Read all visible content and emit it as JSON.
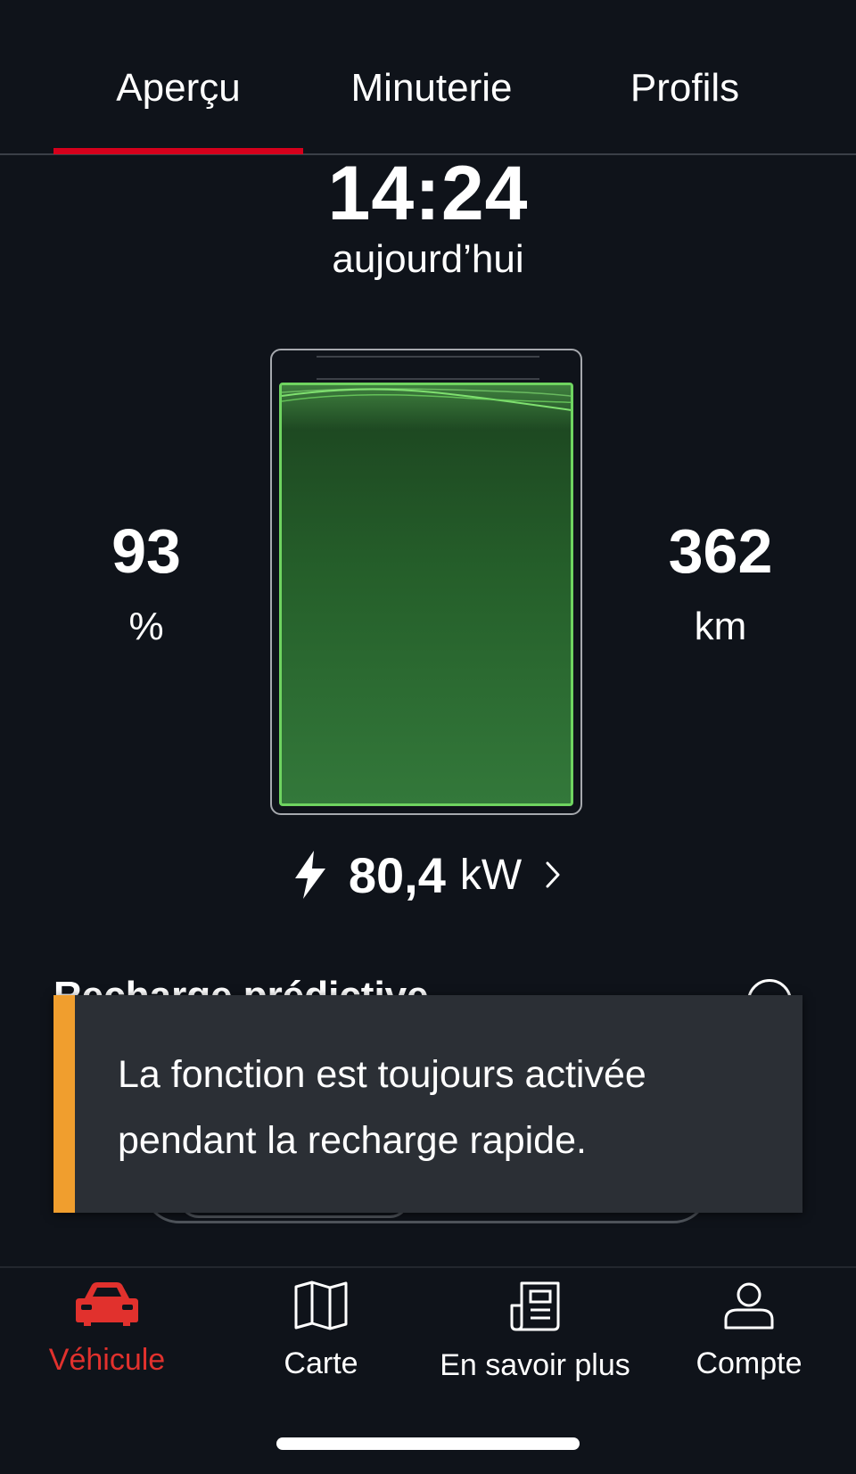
{
  "tabs": {
    "overview": "Aperçu",
    "timer": "Minuterie",
    "profiles": "Profils",
    "active": "overview",
    "active_color": "#d5001c"
  },
  "charging": {
    "end_time": "14:24",
    "end_day": "aujourd’hui",
    "soc_value": "93",
    "soc_unit": "%",
    "range_value": "362",
    "range_unit": "km",
    "battery_fill_fraction": 0.93,
    "battery_color": "#6fd460",
    "power_icon": "lightning-bolt-icon",
    "power_value": "80,4",
    "power_unit": "kW",
    "power_chevron": "chevron-right-icon"
  },
  "toast": {
    "text": "La fonction est toujours activée pendant la recharge rapide.",
    "accent_color": "#f09e2e"
  },
  "section": {
    "title": "Recharge prédictive",
    "info_icon": "info-icon"
  },
  "nav": {
    "vehicle": "Véhicule",
    "map": "Carte",
    "learn": "En savoir plus",
    "account": "Compte",
    "active": "vehicle",
    "active_color": "#e1312d",
    "icons": [
      "car-icon",
      "map-icon",
      "news-icon",
      "user-icon"
    ]
  }
}
